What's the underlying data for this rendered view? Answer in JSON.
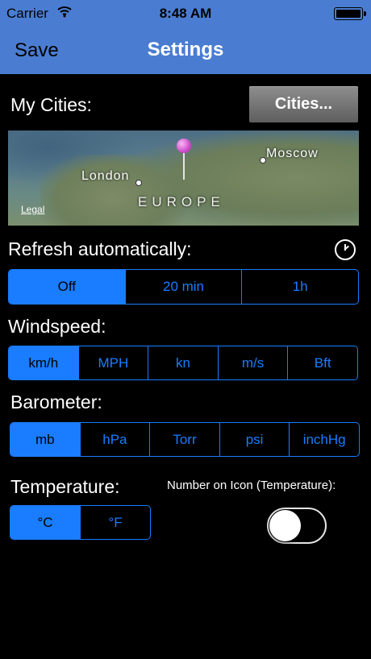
{
  "status_bar": {
    "carrier": "Carrier",
    "time": "8:48 AM"
  },
  "nav": {
    "save_label": "Save",
    "title": "Settings"
  },
  "cities": {
    "label": "My Cities:",
    "button_label": "Cities...",
    "map": {
      "city_1": "London",
      "city_2": "Moscow",
      "region": "EUROPE",
      "legal": "Legal"
    }
  },
  "refresh": {
    "label": "Refresh automatically:",
    "options": [
      "Off",
      "20 min",
      "1h"
    ],
    "selected": "Off"
  },
  "windspeed": {
    "label": "Windspeed:",
    "options": [
      "km/h",
      "MPH",
      "kn",
      "m/s",
      "Bft"
    ],
    "selected": "km/h"
  },
  "barometer": {
    "label": "Barometer:",
    "options": [
      "mb",
      "hPa",
      "Torr",
      "psi",
      "inchHg"
    ],
    "selected": "mb"
  },
  "temperature": {
    "label": "Temperature:",
    "options": [
      "°C",
      "°F"
    ],
    "selected": "°C"
  },
  "icon_number": {
    "label": "Number on Icon (Temperature):",
    "enabled": false
  },
  "colors": {
    "bar": "#4a7dd1",
    "accent": "#1a7cff",
    "background": "#000000"
  }
}
